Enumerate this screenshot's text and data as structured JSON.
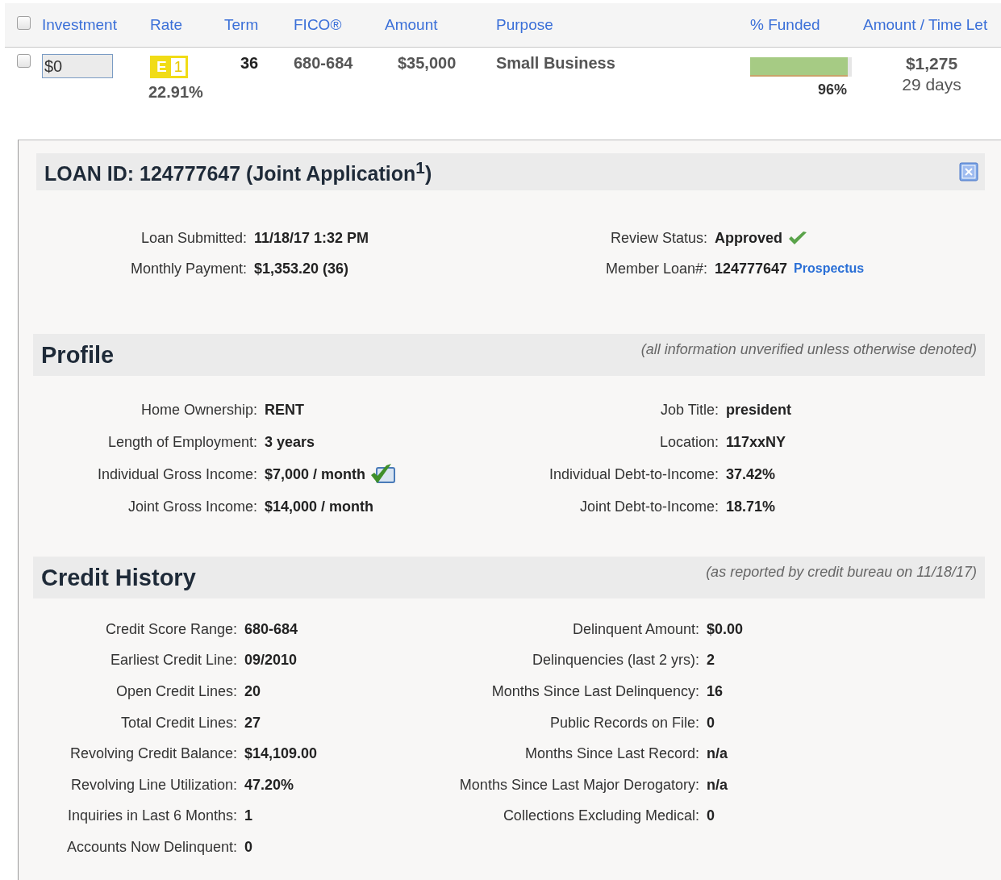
{
  "table": {
    "select_all": {
      "checked": false
    },
    "columns": [
      "Investment",
      "Rate",
      "Term",
      "FICO®",
      "Amount",
      "Purpose",
      "% Funded",
      "Amount / Time Let"
    ],
    "rows": [
      {
        "checked": false,
        "investment": "$0",
        "grade": "E",
        "subgrade": "1",
        "rate": "22.91%",
        "term": "36",
        "fico": "680-684",
        "amount": "$35,000",
        "purpose": "Small Business",
        "level": 0.96,
        "funded": "96%",
        "amount_left": "$1,275",
        "time_left": "29 days"
      }
    ]
  },
  "detail": {
    "title": "LOAN ID: 124777647 (Joint Application$^{1}$)",
    "sections": [
      {
        "left": [
          {
            "label": "Loan Submitted:",
            "value": "11/18/17 1:32 PM"
          },
          {
            "label": "Monthly Payment:",
            "value": "$1,353.20 (36)"
          }
        ],
        "right": [
          {
            "label": "Review Status:",
            "value": "Approved",
            "kind": "check"
          },
          {
            "label": "Member Loan#:",
            "value": "124777647",
            "link": "Prospectus"
          }
        ]
      },
      {
        "heading": "Profile",
        "note": "(all information unverified unless otherwise denoted)",
        "left": [
          {
            "label": "Home Ownership:",
            "value": "RENT"
          },
          {
            "label": "Length of Employment:",
            "value": "3 years"
          },
          {
            "label": "Individual Gross Income:",
            "value": "$7,000 / month",
            "kind": "verified"
          },
          {
            "label": "Joint Gross Income:",
            "value": "$14,000 / month"
          }
        ],
        "right": [
          {
            "label": "Job Title:",
            "value": "president"
          },
          {
            "label": "Location:",
            "value": "117xxNY"
          },
          {
            "label": "Individual Debt-to-Income:",
            "value": "37.42%"
          },
          {
            "label": "Joint Debt-to-Income:",
            "value": "18.71%"
          }
        ]
      },
      {
        "heading": "Credit History",
        "note": "(as reported by credit bureau on 11/18/17)",
        "left": [
          {
            "label": "Credit Score Range:",
            "value": "680-684"
          },
          {
            "label": "Earliest Credit Line:",
            "value": "09/2010"
          },
          {
            "label": "Open Credit Lines:",
            "value": "20"
          },
          {
            "label": "Total Credit Lines:",
            "value": "27"
          },
          {
            "label": "Revolving Credit Balance:",
            "value": "$14,109.00"
          },
          {
            "label": "Revolving Line Utilization:",
            "value": "47.20%"
          },
          {
            "label": "Inquiries in Last 6 Months:",
            "value": "1"
          },
          {
            "label": "Accounts Now Delinquent:",
            "value": "0"
          }
        ],
        "right": [
          {
            "label": "Delinquent Amount:",
            "value": "$0.00"
          },
          {
            "label": "Delinquencies (last 2 yrs):",
            "value": "2"
          },
          {
            "label": "Months Since Last Delinquency:",
            "value": "16"
          },
          {
            "label": "Public Records on File:",
            "value": "0"
          },
          {
            "label": "Months Since Last Record:",
            "value": "n/a"
          },
          {
            "label": "Months Since Last Major Derogatory:",
            "value": "n/a"
          },
          {
            "label": "Collections Excluding Medical:",
            "value": "0"
          }
        ]
      }
    ]
  }
}
